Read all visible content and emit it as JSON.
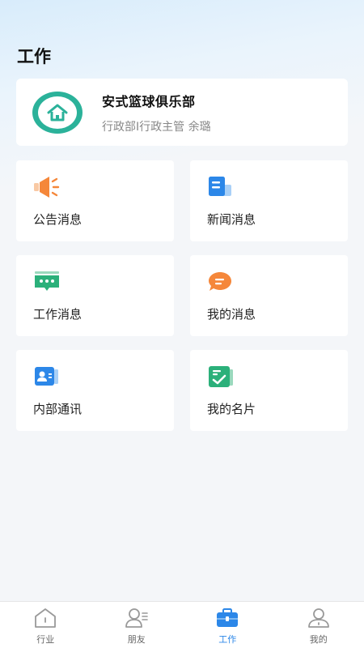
{
  "header": {
    "title": "工作"
  },
  "org": {
    "name": "安式篮球俱乐部",
    "subtitle": "行政部I行政主管  余璐"
  },
  "tiles": [
    {
      "label": "公告消息",
      "icon": "megaphone-icon"
    },
    {
      "label": "新闻消息",
      "icon": "news-icon"
    },
    {
      "label": "工作消息",
      "icon": "chat-dots-icon"
    },
    {
      "label": "我的消息",
      "icon": "message-bubble-icon"
    },
    {
      "label": "内部通讯",
      "icon": "contacts-icon"
    },
    {
      "label": "我的名片",
      "icon": "card-check-icon"
    }
  ],
  "tabbar": {
    "items": [
      {
        "label": "行业",
        "icon": "home-icon"
      },
      {
        "label": "朋友",
        "icon": "friends-icon"
      },
      {
        "label": "工作",
        "icon": "briefcase-icon",
        "active": true
      },
      {
        "label": "我的",
        "icon": "user-icon"
      }
    ]
  },
  "colors": {
    "accent": "#2c87e8",
    "logo": "#2bb29a",
    "orange": "#f5873a",
    "green": "#2bb07a"
  }
}
